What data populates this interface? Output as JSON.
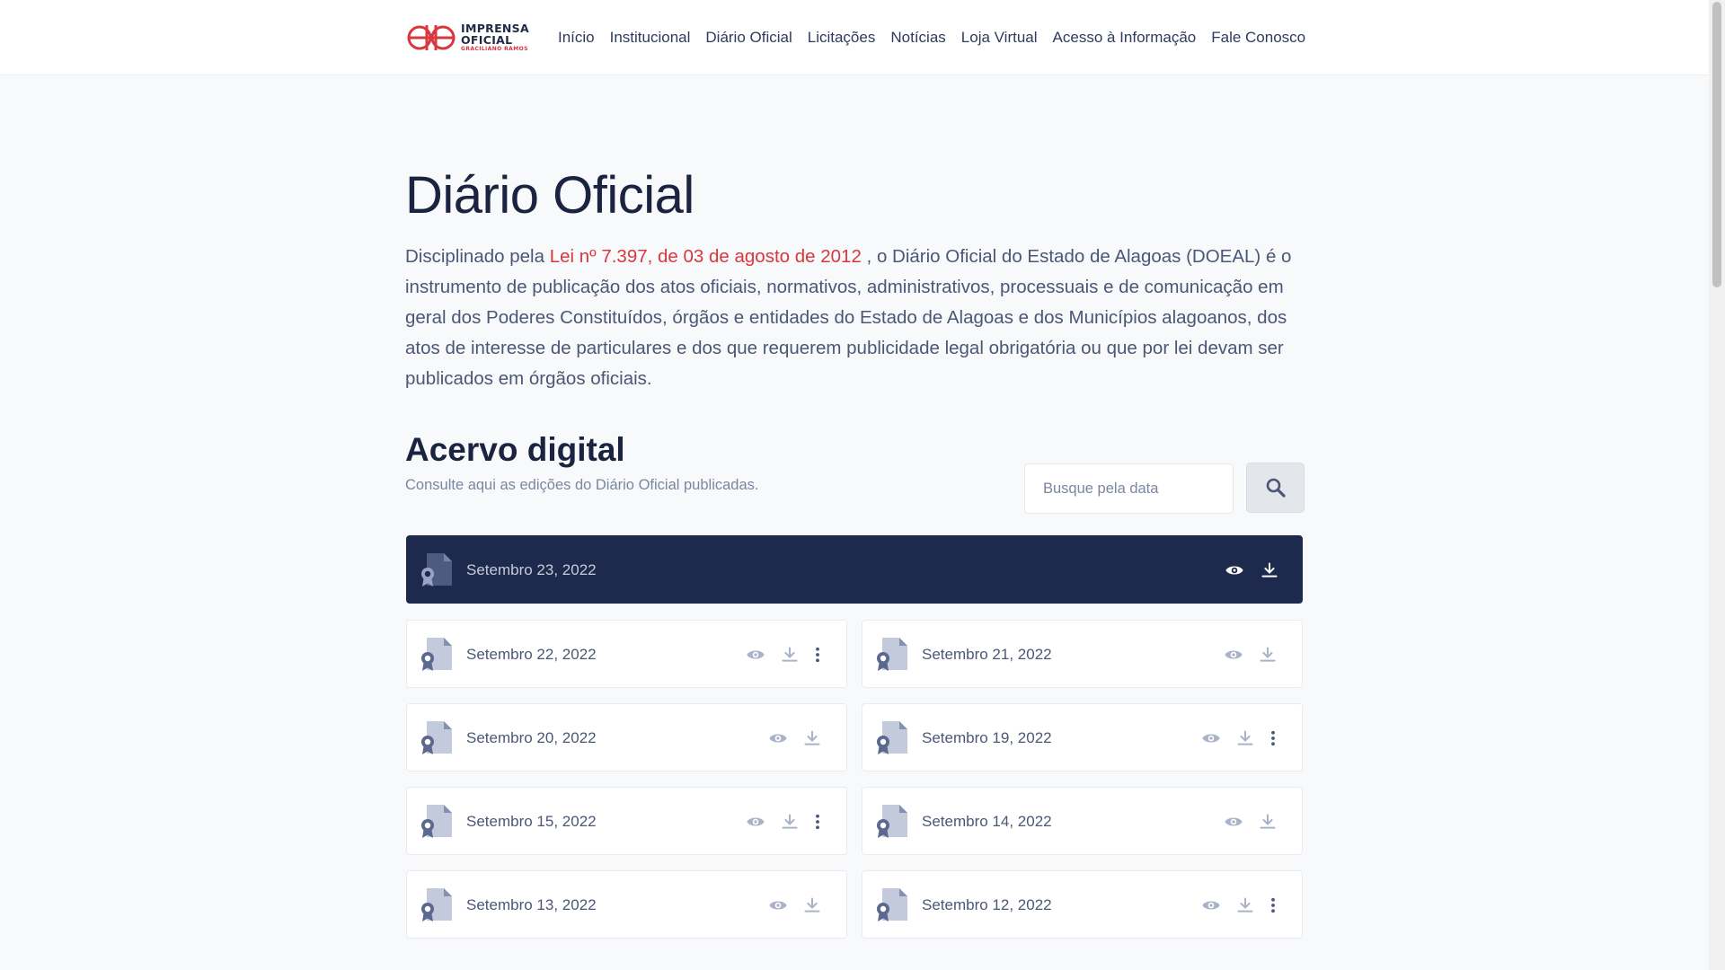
{
  "header": {
    "logo": {
      "line1": "IMPRENSA",
      "line2": "OFICIAL",
      "line3": "GRACILIANO RAMOS"
    },
    "nav": [
      "Início",
      "Institucional",
      "Diário Oficial",
      "Licitações",
      "Notícias",
      "Loja Virtual",
      "Acesso à Informação",
      "Fale Conosco"
    ]
  },
  "main": {
    "title": "Diário Oficial",
    "intro_before": "Disciplinado pela ",
    "intro_link": "Lei nº 7.397, de 03 de agosto de 2012",
    "intro_after": " , o Diário Oficial do Estado de Alagoas (DOEAL) é o instrumento de publicação dos atos oficiais, normativos, administrativos, processuais e de comunicação em geral dos Poderes Constituídos, órgãos e entidades do Estado de Alagoas e dos Municípios alagoanos, dos atos de interesse de particulares e dos que requerem publicidade legal obrigatória ou que por lei devam ser publicados em órgãos oficiais.",
    "acervo_title": "Acervo digital",
    "acervo_subtitle": "Consulte aqui as edições do Diário Oficial publicadas.",
    "search_placeholder": "Busque pela data",
    "featured": {
      "date": "Setembro 23, 2022"
    },
    "editions": [
      {
        "date": "Setembro 22, 2022",
        "has_more": true
      },
      {
        "date": "Setembro 21, 2022",
        "has_more": false
      },
      {
        "date": "Setembro 20, 2022",
        "has_more": false
      },
      {
        "date": "Setembro 19, 2022",
        "has_more": true
      },
      {
        "date": "Setembro 15, 2022",
        "has_more": true
      },
      {
        "date": "Setembro 14, 2022",
        "has_more": false
      },
      {
        "date": "Setembro 13, 2022",
        "has_more": false
      },
      {
        "date": "Setembro 12, 2022",
        "has_more": true
      }
    ]
  },
  "colors": {
    "accent_red": "#d9373f",
    "featured_bg": "#1d2a4d",
    "text_dark": "#1a2440",
    "icon_slate": "#5b6890"
  },
  "icons": {
    "document": "document-ribbon-icon",
    "view": "eye-icon",
    "download": "download-icon",
    "more": "more-vertical-icon",
    "search": "search-icon"
  }
}
